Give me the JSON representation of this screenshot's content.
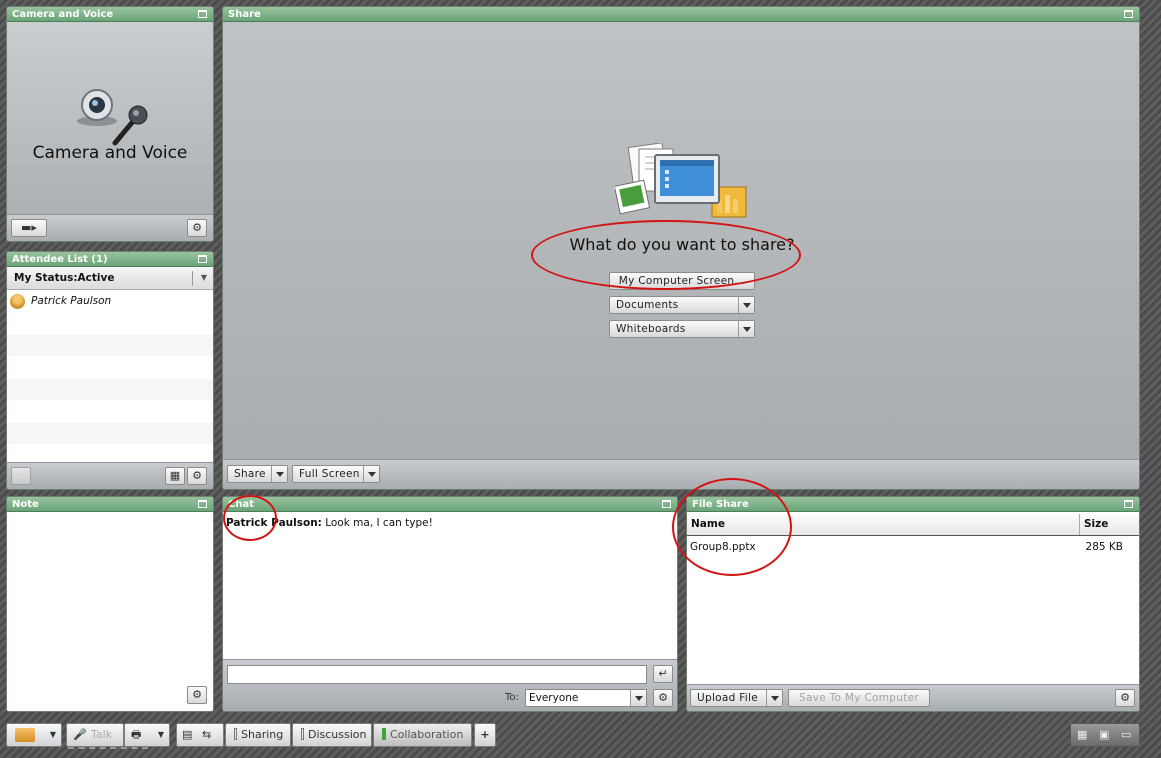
{
  "camera_pod": {
    "title": "Camera and Voice",
    "label": "Camera and Voice"
  },
  "share_pod": {
    "title": "Share",
    "prompt": "What do you want to share?",
    "screen_button": "My Computer Screen...",
    "documents_label": "Documents",
    "whiteboards_label": "Whiteboards",
    "share_menu": "Share",
    "full_screen": "Full Screen"
  },
  "attendee_pod": {
    "title": "Attendee List (1)",
    "status": "My Status:Active",
    "attendees": [
      "Patrick Paulson"
    ]
  },
  "note_pod": {
    "title": "Note"
  },
  "chat_pod": {
    "title": "Chat",
    "messages": [
      {
        "sender": "Patrick Paulson:",
        "text": "Look ma, I can type!"
      }
    ],
    "to_label": "To:",
    "to_value": "Everyone"
  },
  "file_pod": {
    "title": "File Share",
    "col_name": "Name",
    "col_size": "Size",
    "files": [
      {
        "name": "Group8.pptx",
        "size": "285 KB"
      }
    ],
    "upload_label": "Upload File",
    "save_label": "Save To My Computer"
  },
  "toolbar": {
    "talk_label": "Talk",
    "layouts": [
      "Sharing",
      "Discussion",
      "Collaboration"
    ],
    "add_label": "+"
  },
  "colors": {
    "title_bar": "#7fb38a",
    "annotation": "#d21414",
    "active_layout": "#3fa33a"
  }
}
